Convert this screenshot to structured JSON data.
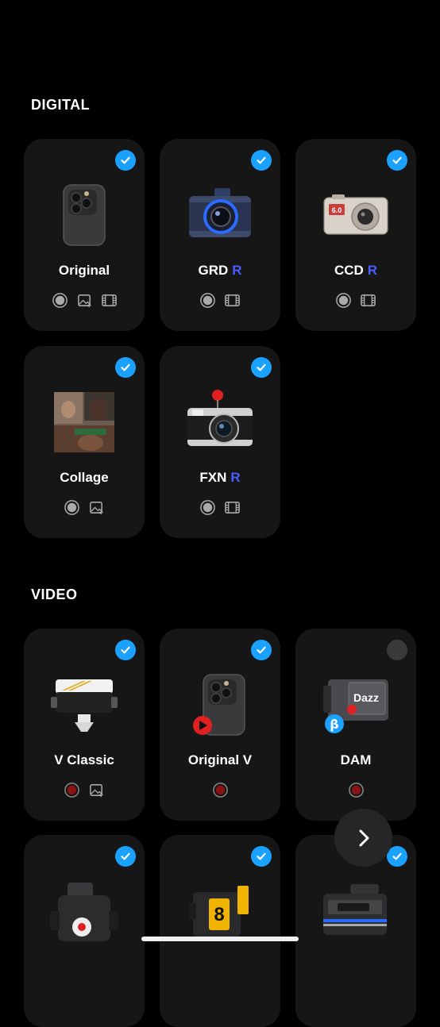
{
  "sections": {
    "digital": {
      "title": "DIGITAL"
    },
    "video": {
      "title": "VIDEO"
    }
  },
  "cameras": {
    "original": {
      "name": "Original",
      "selected": true,
      "features": [
        "record",
        "photo-import",
        "film"
      ]
    },
    "grd": {
      "name": "GRD",
      "badge": "R",
      "selected": true,
      "features": [
        "record",
        "film"
      ]
    },
    "ccd": {
      "name": "CCD",
      "badge": "R",
      "selected": true,
      "features": [
        "record",
        "film"
      ],
      "screen_text": "6.0"
    },
    "collage": {
      "name": "Collage",
      "selected": true,
      "features": [
        "record",
        "photo-import"
      ]
    },
    "fxn": {
      "name": "FXN",
      "badge": "R",
      "selected": true,
      "features": [
        "record",
        "film"
      ]
    },
    "v_classic": {
      "name": "V Classic",
      "selected": true,
      "features": [
        "video-record",
        "photo-import"
      ]
    },
    "original_v": {
      "name": "Original V",
      "selected": true,
      "features": [
        "video-record"
      ]
    },
    "dam": {
      "name": "DAM",
      "selected": false,
      "features": [
        "video-record"
      ],
      "brand_text": "Dazz",
      "beta_badge": "β"
    },
    "video4": {
      "selected": true
    },
    "video5": {
      "selected": true,
      "display_text": "8"
    },
    "video6": {
      "selected": true
    }
  },
  "colors": {
    "accent_check": "#1ba1ff",
    "badge_r": "#4b5cff",
    "card_bg": "#161616",
    "record_red": "#e02020"
  }
}
